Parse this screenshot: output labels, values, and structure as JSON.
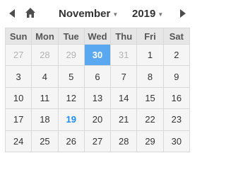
{
  "header": {
    "month": "November",
    "year": "2019",
    "prev_icon": "triangle-left-icon",
    "home_icon": "home-icon",
    "next_icon": "triangle-right-icon",
    "caret_icon": "caret-down-icon"
  },
  "weekdays": [
    "Sun",
    "Mon",
    "Tue",
    "Wed",
    "Thu",
    "Fri",
    "Sat"
  ],
  "weeks": [
    [
      "27",
      "28",
      "29",
      "30",
      "31",
      "1",
      "2"
    ],
    [
      "3",
      "4",
      "5",
      "6",
      "7",
      "8",
      "9"
    ],
    [
      "10",
      "11",
      "12",
      "13",
      "14",
      "15",
      "16"
    ],
    [
      "17",
      "18",
      "19",
      "20",
      "21",
      "22",
      "23"
    ],
    [
      "24",
      "25",
      "26",
      "27",
      "28",
      "29",
      "30"
    ]
  ],
  "colors": {
    "selected_bg": "#5aa9f0",
    "today_text": "#1a8cff",
    "muted_text": "#b3b3b3"
  }
}
